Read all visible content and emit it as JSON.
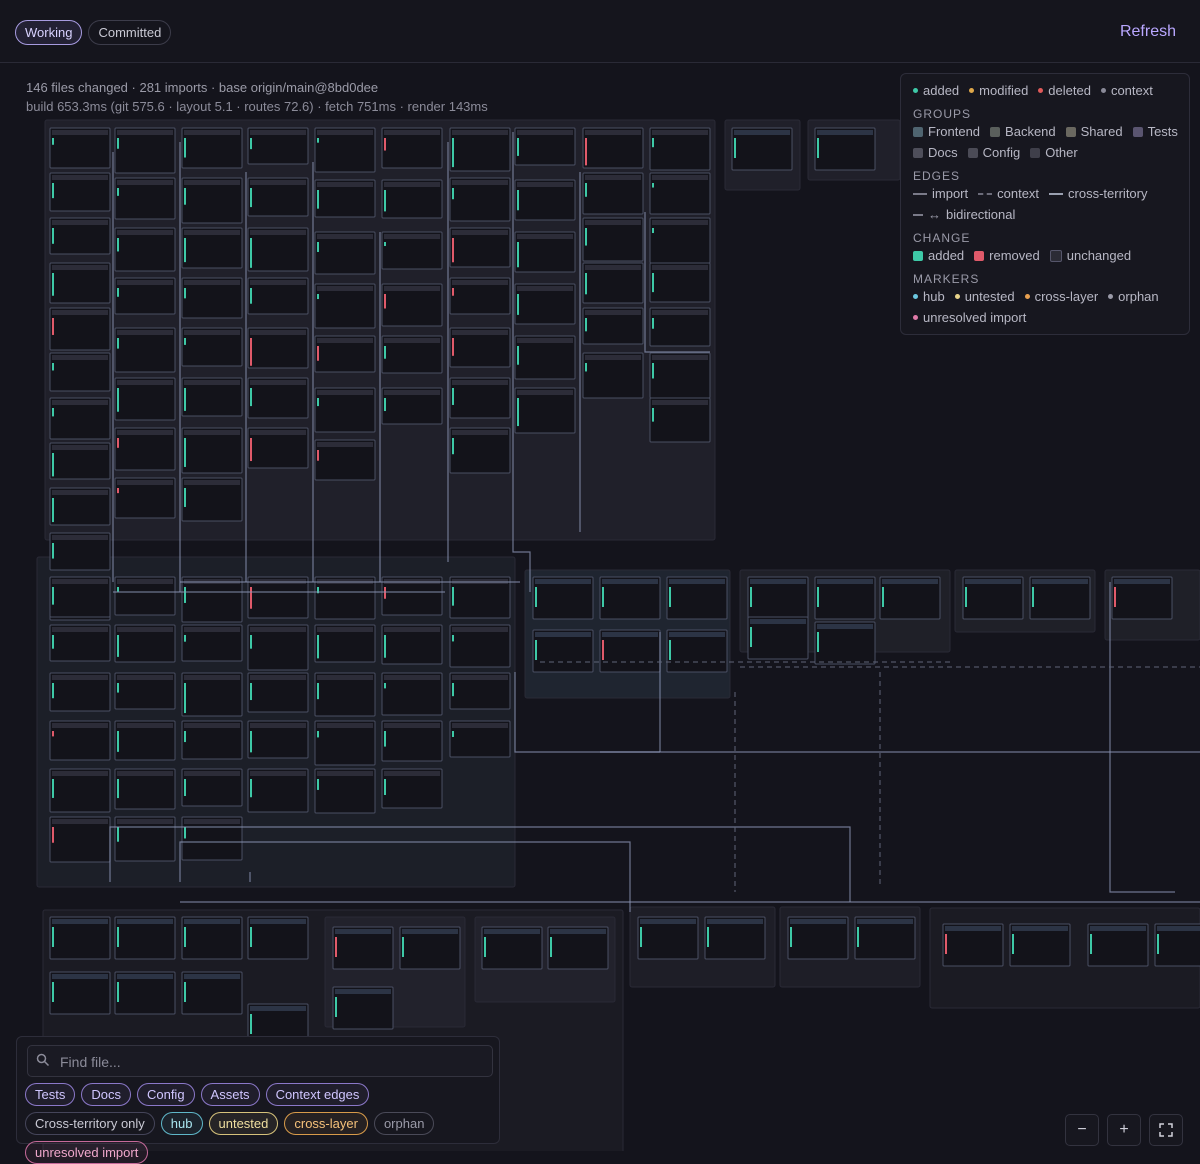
{
  "header": {
    "tabs": [
      {
        "label": "Working",
        "active": true
      },
      {
        "label": "Committed",
        "active": false
      }
    ],
    "refresh_label": "Refresh"
  },
  "stats": {
    "line1": "146 files changed · 281 imports · base origin/main@8bd0dee",
    "line2": "build 653.3ms (git 575.6 · layout 5.1 · routes 72.6) · fetch 751ms · render 143ms"
  },
  "legend": {
    "status": [
      {
        "label": "added",
        "color": "#3ec9a7"
      },
      {
        "label": "modified",
        "color": "#e0a84a"
      },
      {
        "label": "deleted",
        "color": "#e05a5a"
      },
      {
        "label": "context",
        "color": "#8a8a98"
      }
    ],
    "groups_title": "GROUPS",
    "groups": [
      {
        "label": "Frontend",
        "color": "#4f6470"
      },
      {
        "label": "Backend",
        "color": "#5a5f5c"
      },
      {
        "label": "Shared",
        "color": "#6a6860"
      },
      {
        "label": "Tests",
        "color": "#5a5570"
      },
      {
        "label": "Docs",
        "color": "#4e4e5a"
      },
      {
        "label": "Config",
        "color": "#4b4b56"
      },
      {
        "label": "Other",
        "color": "#3f3f4a"
      }
    ],
    "edges_title": "EDGES",
    "edges": [
      {
        "label": "import",
        "style": "solid"
      },
      {
        "label": "context",
        "style": "dashed"
      },
      {
        "label": "cross-territory",
        "style": "solid"
      },
      {
        "label": "bidirectional",
        "style": "arrow"
      }
    ],
    "change_title": "CHANGE",
    "change": [
      {
        "label": "added",
        "color": "#3ec9a7"
      },
      {
        "label": "removed",
        "color": "#e05a6a"
      },
      {
        "label": "unchanged",
        "color": "#2b2b35"
      }
    ],
    "markers_title": "MARKERS",
    "markers": [
      {
        "label": "hub",
        "color": "#6cc8e0"
      },
      {
        "label": "untested",
        "color": "#e8d48a"
      },
      {
        "label": "cross-layer",
        "color": "#e8a050"
      },
      {
        "label": "orphan",
        "color": "#9a9aa8"
      },
      {
        "label": "unresolved import",
        "color": "#e07aa8"
      }
    ]
  },
  "search": {
    "placeholder": "Find file...",
    "value": ""
  },
  "filters": [
    {
      "label": "Tests",
      "kind": "f"
    },
    {
      "label": "Docs",
      "kind": "f"
    },
    {
      "label": "Config",
      "kind": "f"
    },
    {
      "label": "Assets",
      "kind": "f"
    },
    {
      "label": "Context edges",
      "kind": "f"
    },
    {
      "label": "Cross-territory only",
      "kind": "plain"
    },
    {
      "label": "hub",
      "kind": "hub"
    },
    {
      "label": "untested",
      "kind": "untested"
    },
    {
      "label": "cross-layer",
      "kind": "cross"
    },
    {
      "label": "orphan",
      "kind": "orphan"
    },
    {
      "label": "unresolved import",
      "kind": "unres"
    }
  ],
  "zoom": {
    "out_label": "−",
    "in_label": "+",
    "fit_icon": "fit-screen-icon"
  },
  "colors": {
    "accent": "#b9a7ff",
    "added": "#3ec9a7",
    "removed": "#e05a6a",
    "edge": "#9aa6c4"
  }
}
